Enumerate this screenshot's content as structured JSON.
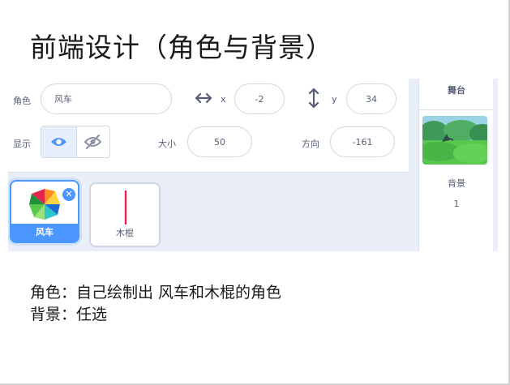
{
  "slide": {
    "title": "前端设计（角色与背景）",
    "line1": "角色：自己绘制出  风车和木棍的角色",
    "line2": "背景：任选"
  },
  "sprite_info": {
    "sprite_label": "角色",
    "sprite_name": "风车",
    "x_label": "x",
    "x_value": "-2",
    "y_label": "y",
    "y_value": "34",
    "show_label": "显示",
    "size_label": "大小",
    "size_value": "50",
    "direction_label": "方向",
    "direction_value": "-161",
    "visible": true
  },
  "sprites": [
    {
      "name": "风车",
      "selected": true
    },
    {
      "name": "木棍",
      "selected": false
    }
  ],
  "stage": {
    "header": "舞台",
    "backdrops_label": "背景",
    "backdrops_count": "1"
  },
  "colors": {
    "accent": "#4c97ff",
    "text": "#575e75",
    "stick": "#e6224f"
  },
  "icons": [
    "horizontal-arrows-icon",
    "vertical-arrows-icon",
    "eye-icon",
    "eye-off-icon",
    "delete-icon",
    "pinwheel-costume-icon",
    "stick-costume-icon"
  ]
}
